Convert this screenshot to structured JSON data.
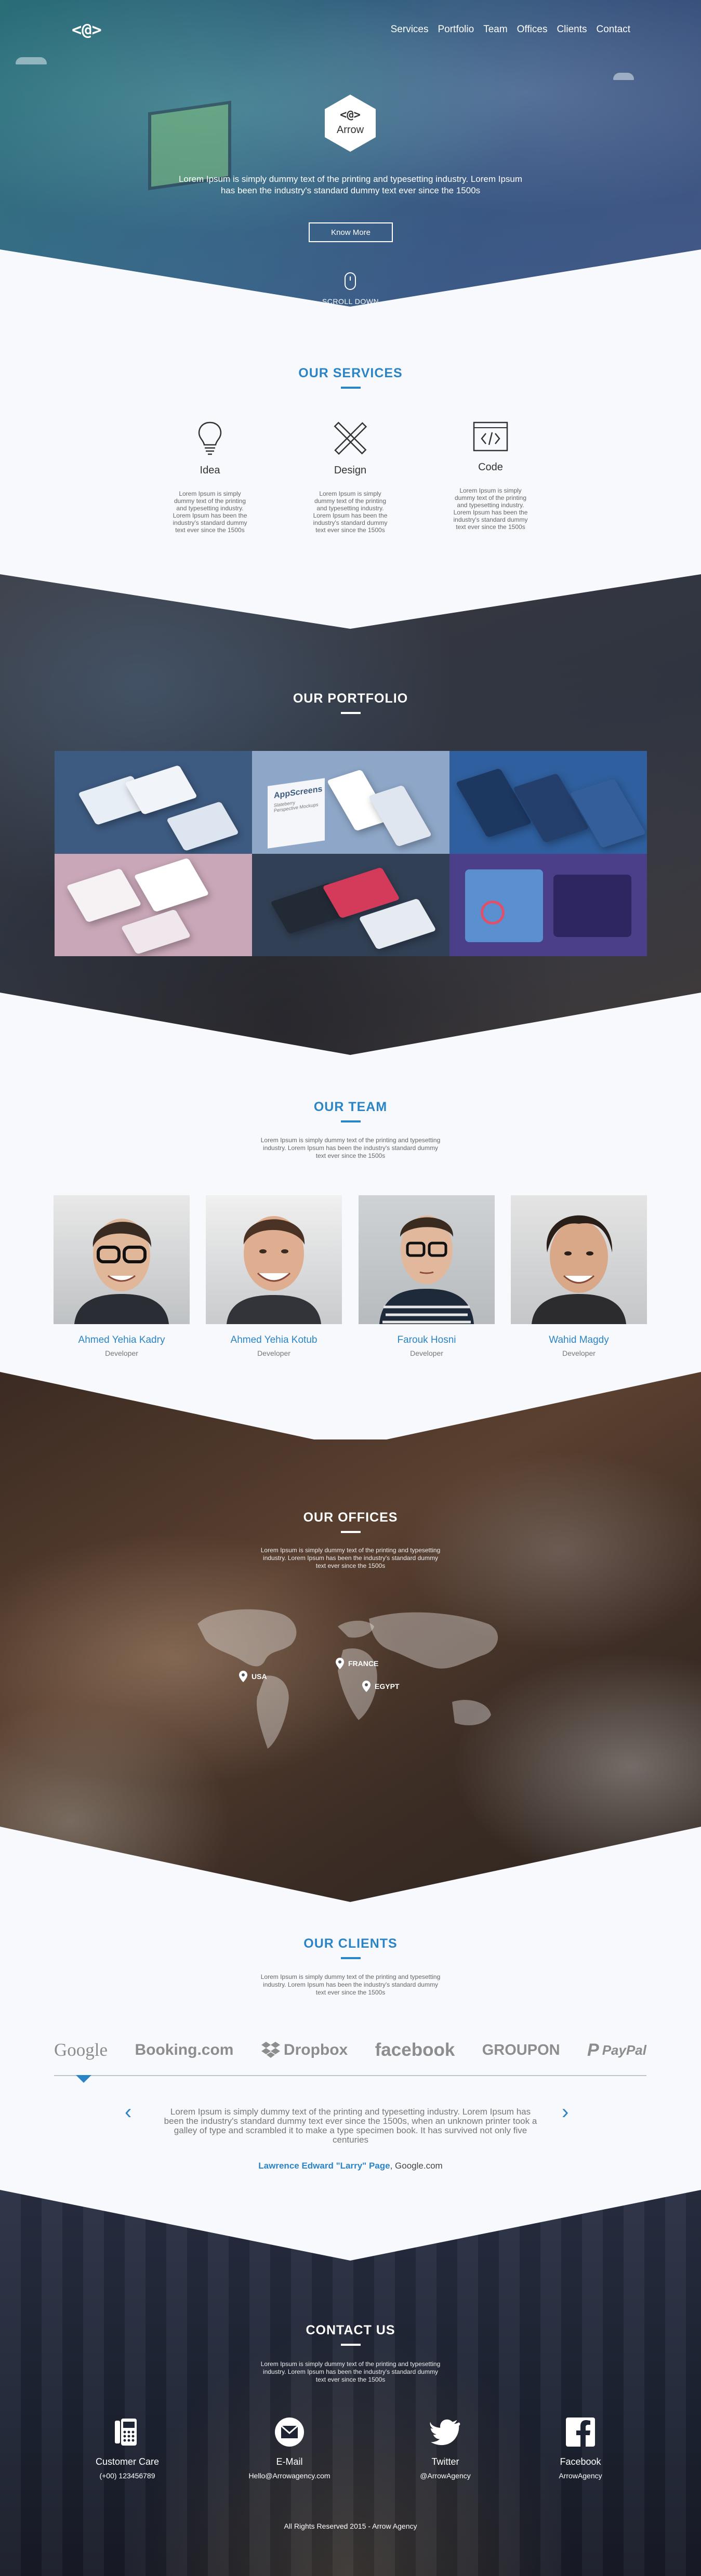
{
  "nav": {
    "logo_glyph": "<@>",
    "items": [
      "Services",
      "Portfolio",
      "Team",
      "Offices",
      "Clients",
      "Contact"
    ]
  },
  "hero": {
    "brand": "Arrow",
    "text": "Lorem Ipsum is simply dummy text of the printing and typesetting industry. Lorem Ipsum has been the industry's standard dummy text ever since the 1500s",
    "button": "Know More",
    "scroll": "SCROLL DOWN"
  },
  "services": {
    "title": "OUR SERVICES",
    "items": [
      {
        "icon": "lightbulb-icon",
        "label": "Idea",
        "text": "Lorem Ipsum is simply dummy text of the printing and typesetting industry. Lorem Ipsum has been the industry's standard dummy text ever since the 1500s"
      },
      {
        "icon": "pencil-ruler-icon",
        "label": "Design",
        "text": "Lorem Ipsum is simply dummy text of the printing and typesetting industry. Lorem Ipsum has been the industry's standard dummy text ever since the 1500s"
      },
      {
        "icon": "code-icon",
        "label": "Code",
        "text": "Lorem Ipsum is simply dummy text of the printing and typesetting industry. Lorem Ipsum has been the industry's standard dummy text ever since the 1500s"
      }
    ]
  },
  "portfolio": {
    "title": "OUR PORTFOLIO",
    "tile_text": [
      "AppScreens",
      "Slateberry Perspective Mockups"
    ]
  },
  "team": {
    "title": "OUR TEAM",
    "text": "Lorem Ipsum is simply dummy text of the printing and typesetting industry. Lorem Ipsum has been the industry's standard dummy text ever since the 1500s",
    "members": [
      {
        "name": "Ahmed Yehia Kadry",
        "role": "Developer"
      },
      {
        "name": "Ahmed Yehia Kotub",
        "role": "Developer"
      },
      {
        "name": "Farouk Hosni",
        "role": "Developer"
      },
      {
        "name": "Wahid Magdy",
        "role": "Developer"
      }
    ]
  },
  "offices": {
    "title": "OUR OFFICES",
    "text": "Lorem Ipsum is simply dummy text of the printing and typesetting industry. Lorem Ipsum has been the industry's standard dummy text ever since the 1500s",
    "locations": [
      "USA",
      "FRANCE",
      "EGYPT"
    ]
  },
  "clients": {
    "title": "OUR CLIENTS",
    "text": "Lorem Ipsum is simply dummy text of the printing and typesetting industry. Lorem Ipsum has been the industry's standard dummy text ever since the 1500s",
    "logos": [
      "Google",
      "Booking.com",
      "Dropbox",
      "facebook",
      "GROUPON",
      "PayPal"
    ],
    "quote": "Lorem Ipsum is simply dummy text of the printing and typesetting industry. Lorem Ipsum has been the industry's standard dummy text ever since the 1500s, when an unknown printer took a galley of type and scrambled it to make a type specimen book. It has survived not only five centuries",
    "author_name": "Lawrence Edward \"Larry\" Page",
    "author_company": ", Google.com"
  },
  "contact": {
    "title": "CONTACT US",
    "text": "Lorem Ipsum is simply dummy text of the printing and typesetting industry. Lorem Ipsum has been the industry's standard dummy text ever since the 1500s",
    "items": [
      {
        "icon": "phone-icon",
        "label": "Customer Care",
        "value": "(+00) 123456789"
      },
      {
        "icon": "email-icon",
        "label": "E-Mail",
        "value": "Hello@Arrowagency.com"
      },
      {
        "icon": "twitter-icon",
        "label": "Twitter",
        "value": "@ArrowAgency"
      },
      {
        "icon": "facebook-icon",
        "label": "Facebook",
        "value": "ArrowAgency"
      }
    ],
    "footer": "All Rights Reserved 2015 - Arrow Agency"
  },
  "colors": {
    "accent": "#2a84c6",
    "light_bg": "#f8f9fc"
  }
}
